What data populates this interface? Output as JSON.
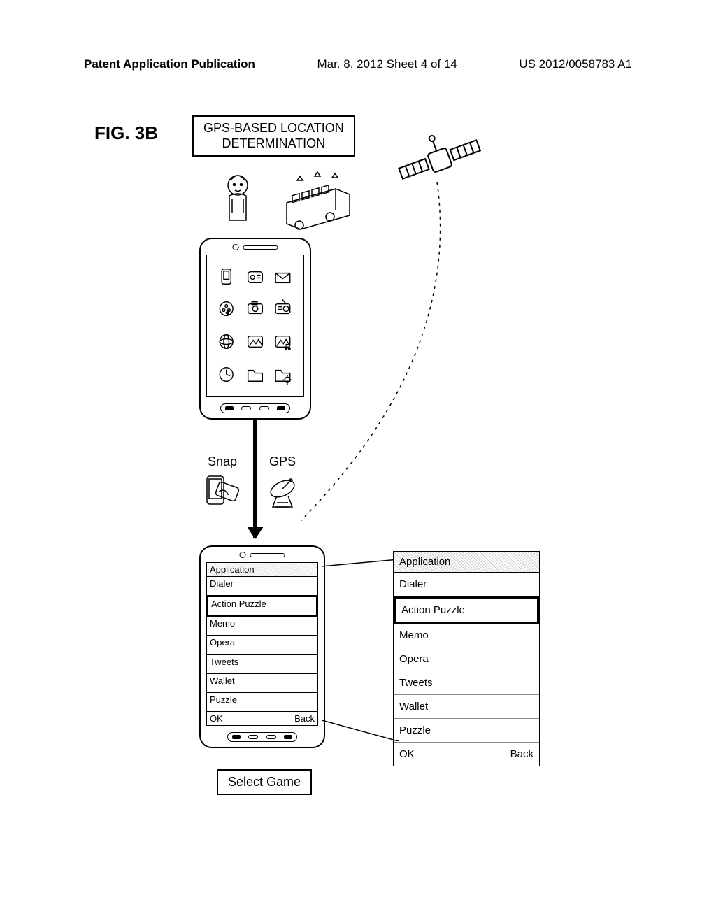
{
  "header": {
    "left": "Patent Application Publication",
    "center": "Mar. 8, 2012  Sheet 4 of 14",
    "right": "US 2012/0058783 A1"
  },
  "figure_label": "FIG.  3B",
  "title_box": "GPS-BASED LOCATION\nDETERMINATION",
  "snap_label": "Snap",
  "gps_label": "GPS",
  "app_list_small": {
    "header": "Application",
    "items": [
      "Dialer",
      "Action Puzzle",
      "Memo",
      "Opera",
      "Tweets",
      "Wallet",
      "Puzzle"
    ],
    "ok": "OK",
    "back": "Back",
    "selected_index": 1
  },
  "app_list_big": {
    "header": "Application",
    "items": [
      "Dialer",
      "Action Puzzle",
      "Memo",
      "Opera",
      "Tweets",
      "Wallet",
      "Puzzle"
    ],
    "ok": "OK",
    "back": "Back",
    "selected_index": 1
  },
  "select_game": "Select Game"
}
